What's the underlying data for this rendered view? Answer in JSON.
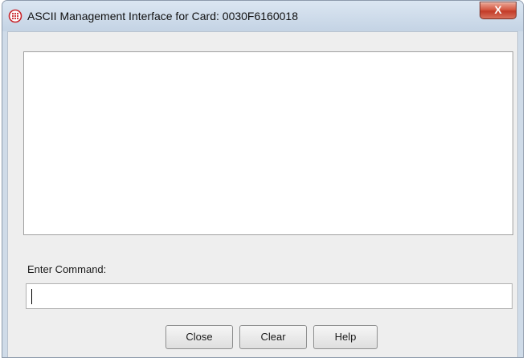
{
  "window": {
    "title": "ASCII Management Interface for Card: 0030F6160018",
    "close_glyph": "X",
    "app_icon": "globe-network-icon",
    "accent": "#c23b28"
  },
  "console": {
    "output": "",
    "command_label": "Enter Command:",
    "command_value": ""
  },
  "buttons": {
    "close": "Close",
    "clear": "Clear",
    "help": "Help"
  }
}
